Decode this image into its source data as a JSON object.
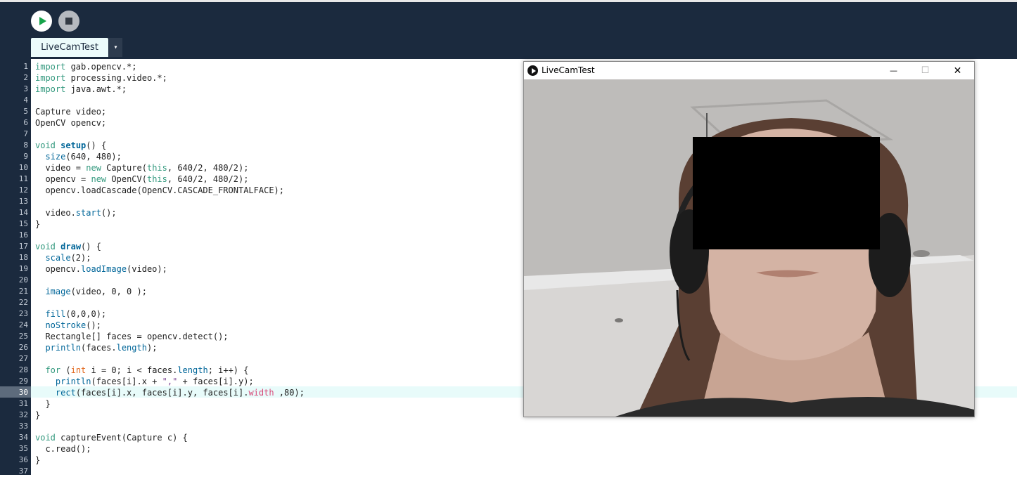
{
  "toolbar": {
    "run_button": "play-icon",
    "stop_button": "stop-icon"
  },
  "tabs": [
    {
      "label": "LiveCamTest",
      "active": true
    }
  ],
  "tab_menu_icon": "▾",
  "editor": {
    "current_line": 30,
    "lines": [
      {
        "n": "1",
        "segments": [
          {
            "t": "import",
            "c": "kw"
          },
          {
            "t": " gab.opencv.*;"
          }
        ]
      },
      {
        "n": "2",
        "segments": [
          {
            "t": "import",
            "c": "kw"
          },
          {
            "t": " processing.video.*;"
          }
        ]
      },
      {
        "n": "3",
        "segments": [
          {
            "t": "import",
            "c": "kw"
          },
          {
            "t": " java.awt.*;"
          }
        ]
      },
      {
        "n": "4",
        "segments": []
      },
      {
        "n": "5",
        "segments": [
          {
            "t": "Capture video;"
          }
        ]
      },
      {
        "n": "6",
        "segments": [
          {
            "t": "OpenCV opencv;"
          }
        ]
      },
      {
        "n": "7",
        "segments": []
      },
      {
        "n": "8",
        "segments": [
          {
            "t": "void",
            "c": "kw"
          },
          {
            "t": " "
          },
          {
            "t": "setup",
            "c": "fn bold"
          },
          {
            "t": "() {"
          }
        ]
      },
      {
        "n": "9",
        "segments": [
          {
            "t": "  "
          },
          {
            "t": "size",
            "c": "fn"
          },
          {
            "t": "(640, 480);"
          }
        ]
      },
      {
        "n": "10",
        "segments": [
          {
            "t": "  video = "
          },
          {
            "t": "new",
            "c": "kw"
          },
          {
            "t": " Capture("
          },
          {
            "t": "this",
            "c": "kw"
          },
          {
            "t": ", 640/2, 480/2);"
          }
        ]
      },
      {
        "n": "11",
        "segments": [
          {
            "t": "  opencv = "
          },
          {
            "t": "new",
            "c": "kw"
          },
          {
            "t": " OpenCV("
          },
          {
            "t": "this",
            "c": "kw"
          },
          {
            "t": ", 640/2, 480/2);"
          }
        ]
      },
      {
        "n": "12",
        "segments": [
          {
            "t": "  opencv.loadCascade(OpenCV.CASCADE_FRONTALFACE);"
          }
        ]
      },
      {
        "n": "13",
        "segments": []
      },
      {
        "n": "14",
        "segments": [
          {
            "t": "  video."
          },
          {
            "t": "start",
            "c": "fn"
          },
          {
            "t": "();"
          }
        ]
      },
      {
        "n": "15",
        "segments": [
          {
            "t": "}"
          }
        ]
      },
      {
        "n": "16",
        "segments": []
      },
      {
        "n": "17",
        "segments": [
          {
            "t": "void",
            "c": "kw"
          },
          {
            "t": " "
          },
          {
            "t": "draw",
            "c": "fn bold"
          },
          {
            "t": "() {"
          }
        ]
      },
      {
        "n": "18",
        "segments": [
          {
            "t": "  "
          },
          {
            "t": "scale",
            "c": "fn"
          },
          {
            "t": "(2);"
          }
        ]
      },
      {
        "n": "19",
        "segments": [
          {
            "t": "  opencv."
          },
          {
            "t": "loadImage",
            "c": "fn"
          },
          {
            "t": "(video);"
          }
        ]
      },
      {
        "n": "20",
        "segments": []
      },
      {
        "n": "21",
        "segments": [
          {
            "t": "  "
          },
          {
            "t": "image",
            "c": "fn"
          },
          {
            "t": "(video, 0, 0 );"
          }
        ]
      },
      {
        "n": "22",
        "segments": []
      },
      {
        "n": "23",
        "segments": [
          {
            "t": "  "
          },
          {
            "t": "fill",
            "c": "fn"
          },
          {
            "t": "(0,0,0);"
          }
        ]
      },
      {
        "n": "24",
        "segments": [
          {
            "t": "  "
          },
          {
            "t": "noStroke",
            "c": "fn"
          },
          {
            "t": "();"
          }
        ]
      },
      {
        "n": "25",
        "segments": [
          {
            "t": "  Rectangle[] faces = opencv.detect();"
          }
        ]
      },
      {
        "n": "26",
        "segments": [
          {
            "t": "  "
          },
          {
            "t": "println",
            "c": "fn"
          },
          {
            "t": "(faces."
          },
          {
            "t": "length",
            "c": "fn"
          },
          {
            "t": ");"
          }
        ]
      },
      {
        "n": "27",
        "segments": []
      },
      {
        "n": "28",
        "segments": [
          {
            "t": "  "
          },
          {
            "t": "for",
            "c": "kw"
          },
          {
            "t": " ("
          },
          {
            "t": "int",
            "c": "typ"
          },
          {
            "t": " i = 0; i < faces."
          },
          {
            "t": "length",
            "c": "fn"
          },
          {
            "t": "; i++) {"
          }
        ]
      },
      {
        "n": "29",
        "segments": [
          {
            "t": "    "
          },
          {
            "t": "println",
            "c": "fn"
          },
          {
            "t": "(faces[i].x + "
          },
          {
            "t": "\",\"",
            "c": "str"
          },
          {
            "t": " + faces[i].y);"
          }
        ]
      },
      {
        "n": "30",
        "segments": [
          {
            "t": "    "
          },
          {
            "t": "rect",
            "c": "fn"
          },
          {
            "t": "(faces[i].x, faces[i].y, faces[i]."
          },
          {
            "t": "width",
            "c": "field"
          },
          {
            "t": " ,80);"
          }
        ]
      },
      {
        "n": "31",
        "segments": [
          {
            "t": "  }"
          }
        ]
      },
      {
        "n": "32",
        "segments": [
          {
            "t": "}"
          }
        ]
      },
      {
        "n": "33",
        "segments": []
      },
      {
        "n": "34",
        "segments": [
          {
            "t": "void",
            "c": "kw"
          },
          {
            "t": " captureEvent(Capture c) {"
          }
        ]
      },
      {
        "n": "35",
        "segments": [
          {
            "t": "  c.read();"
          }
        ]
      },
      {
        "n": "36",
        "segments": [
          {
            "t": "}"
          }
        ]
      },
      {
        "n": "37",
        "segments": []
      }
    ]
  },
  "sketch_window": {
    "title": "LiveCamTest",
    "minimize": "—",
    "maximize": "☐",
    "close": "✕",
    "content": "webcam-video-feed"
  }
}
